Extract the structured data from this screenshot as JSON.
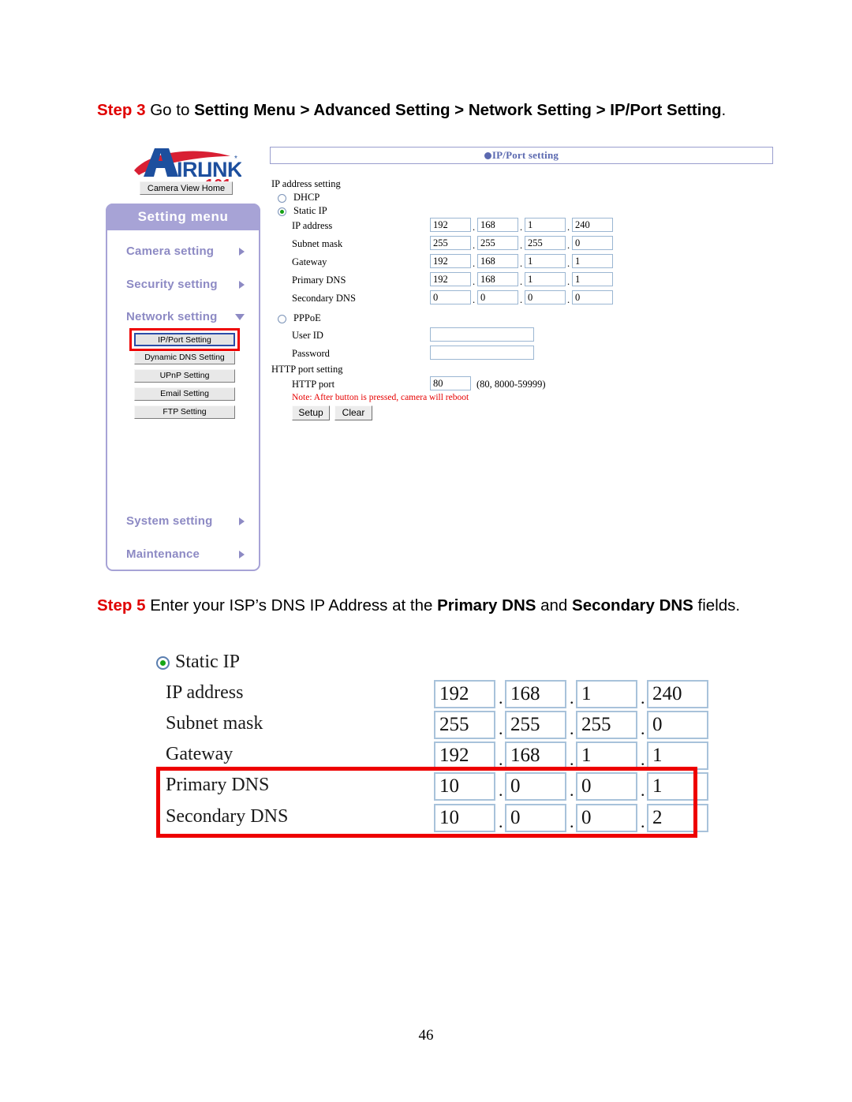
{
  "document": {
    "page_number": "46"
  },
  "steps": {
    "step3": {
      "label": "Step 3",
      "text_plain": " Go to ",
      "text_bold": "Setting Menu > Advanced Setting > Network Setting > IP/Port Setting",
      "text_tail": "."
    },
    "step5": {
      "label": "Step 5",
      "text_plain": " Enter your ISP’s DNS IP Address at the ",
      "bold_1": "Primary DNS",
      "mid": " and ",
      "bold_2": "Secondary DNS",
      "tail": " fields."
    }
  },
  "capture": {
    "logo": {
      "brand_main": "IRLINK",
      "brand_letter": "A",
      "brand_number": "101"
    },
    "camera_view_home_button": "Camera View Home",
    "sidebar": {
      "header": "Setting menu",
      "items": [
        {
          "label": "Camera setting",
          "arrow": "right"
        },
        {
          "label": "Security setting",
          "arrow": "right"
        },
        {
          "label": "Network setting",
          "arrow": "down"
        },
        {
          "label": "System setting",
          "arrow": "right"
        },
        {
          "label": "Maintenance",
          "arrow": "right"
        }
      ],
      "sub_items": [
        {
          "label": "IP/Port Setting",
          "selected": true
        },
        {
          "label": "Dynamic DNS Setting",
          "selected": false
        },
        {
          "label": "UPnP Setting",
          "selected": false
        },
        {
          "label": "Email Setting",
          "selected": false
        },
        {
          "label": "FTP Setting",
          "selected": false
        }
      ]
    },
    "form": {
      "title": "IP/Port setting",
      "section_ip": "IP address setting",
      "dhcp_label": "DHCP",
      "dhcp_selected": false,
      "static_ip_label": "Static IP",
      "static_ip_selected": true,
      "rows": [
        {
          "label": "IP address",
          "octets": [
            "192",
            "168",
            "1",
            "240"
          ]
        },
        {
          "label": "Subnet mask",
          "octets": [
            "255",
            "255",
            "255",
            "0"
          ]
        },
        {
          "label": "Gateway",
          "octets": [
            "192",
            "168",
            "1",
            "1"
          ]
        },
        {
          "label": "Primary DNS",
          "octets": [
            "192",
            "168",
            "1",
            "1"
          ]
        },
        {
          "label": "Secondary DNS",
          "octets": [
            "0",
            "0",
            "0",
            "0"
          ]
        }
      ],
      "pppoe_label": "PPPoE",
      "pppoe_selected": false,
      "user_id_label": "User ID",
      "user_id_value": "",
      "password_label": "Password",
      "password_value": "",
      "http_section": "HTTP port setting",
      "http_port_label": "HTTP port",
      "http_port_value": "80",
      "http_port_hint": "(80, 8000-59999)",
      "note": "Note: After button is pressed, camera will reboot",
      "setup_button": "Setup",
      "clear_button": "Clear"
    }
  },
  "detail": {
    "static_ip_label": "Static IP",
    "rows": [
      {
        "label": "IP address",
        "octets": [
          "192",
          "168",
          "1",
          "240"
        ],
        "highlighted": false
      },
      {
        "label": "Subnet mask",
        "octets": [
          "255",
          "255",
          "255",
          "0"
        ],
        "highlighted": false
      },
      {
        "label": "Gateway",
        "octets": [
          "192",
          "168",
          "1",
          "1"
        ],
        "highlighted": false
      },
      {
        "label": "Primary DNS",
        "octets": [
          "10",
          "0",
          "0",
          "1"
        ],
        "highlighted": true
      },
      {
        "label": "Secondary DNS",
        "octets": [
          "10",
          "0",
          "0",
          "2"
        ],
        "highlighted": true
      }
    ]
  },
  "colors": {
    "step_label_red": "#e00000",
    "highlight_red": "#ee0000",
    "sidebar_purple": "#a7a3d6",
    "title_blue": "#5b69b0",
    "note_red": "#e60000",
    "radio_green": "#13a013"
  }
}
